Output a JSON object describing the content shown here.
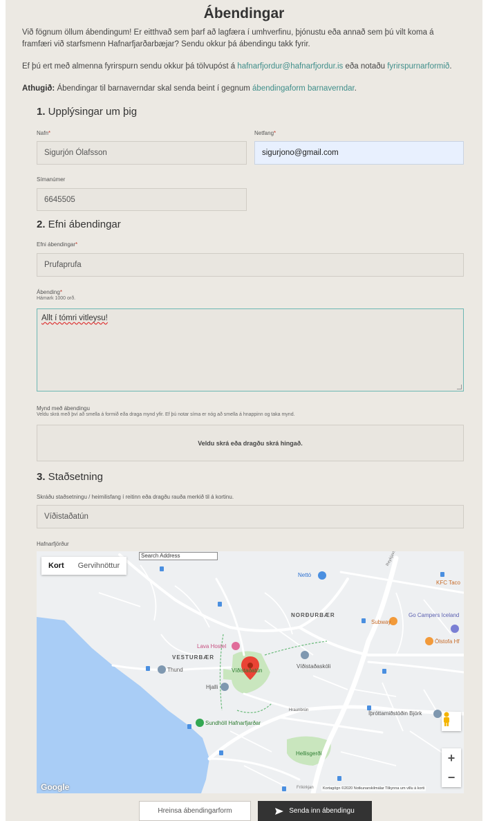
{
  "page": {
    "title": "Ábendingar",
    "intro_1": "Við fögnum öllum ábendingum! Er eitthvað sem þarf að lagfæra í umhverfinu, þjónustu eða annað sem þú vilt koma á framfæri við starfsmenn Hafnarfjarðarbæjar? Sendu okkur þá ábendingu takk fyrir.",
    "intro_2_pre": "Ef þú ert með almenna fyrirspurn sendu okkur þá tölvupóst á ",
    "intro_2_email": "hafnarfjordur@hafnarfjordur.is",
    "intro_2_mid": " eða notaðu ",
    "intro_2_link": "fyrirspurnarformið",
    "intro_2_end": ".",
    "note_bold": "Athugið:",
    "note_text": " Ábendingar til barnaverndar skal senda beint í gegnum ",
    "note_link": "ábendingaform barnaverndar",
    "note_end": "."
  },
  "section1": {
    "num": "1.",
    "title": " Upplýsingar um þig",
    "name_label": "Nafn",
    "name_value": "Sigurjón Ólafsson",
    "email_label": "Netfang",
    "email_value": "sigurjono@gmail.com",
    "phone_label": "Símanúmer",
    "phone_value": "6645505"
  },
  "section2": {
    "num": "2.",
    "title": " Efni ábendingar",
    "subject_label": "Efni ábendingar",
    "subject_value": "Prufaprufa",
    "message_label": "Ábending",
    "message_hint": "Hámark 1000 orð.",
    "message_value": "Allt í tómri vitleysu!",
    "image_label": "Mynd með ábendingu",
    "image_hint": "Veldu skrá með því að smella á formið eða draga mynd yfir. Ef þú notar síma er nóg að smella á hnappinn og taka mynd.",
    "dropzone_text": "Veldu skrá eða dragðu skrá hingað."
  },
  "section3": {
    "num": "3.",
    "title": " Staðsetning",
    "location_label": "Skráðu staðsetningu / heimilisfang í reitinn eða dragðu rauða merkið til á kortinu.",
    "location_value": "Víðistaðatún",
    "town_label": "Hafnarfjörður"
  },
  "map": {
    "tab_map": "Kort",
    "tab_satellite": "Gervihnöttur",
    "search_placeholder": "Search Address",
    "labels": {
      "netto": "Nettó",
      "kfc": "KFC Taco",
      "nordurbaer": "NORÐURBÆR",
      "go_campers": "Go Campers Iceland",
      "subway": "Subway",
      "olstofa": "Ölstofa Hf",
      "lava_hostel": "Lava Hostel",
      "vesturbaer": "VESTURBÆR",
      "vidistadatun": "Víðistaðatún",
      "vidistadaskoli": "Víðistaðaskóli",
      "thund": "Thund",
      "hjalli": "Hjalli",
      "hraunbrun": "Hraunbrún",
      "ithrotta": "Íþróttamiðstöðin Björk",
      "sundholl": "Sundhöll Hafnarfjarðar",
      "hellisgerdi": "Hellisgerði",
      "reykjavikurvegur": "Reykjavíkurvegur",
      "frikirkjan": "Fríkirkjan"
    },
    "zoom_in": "+",
    "zoom_out": "−",
    "google": "Google",
    "attribution": "Kortagögn ©2020   Notkunarskilmálar   Tilkynna um villu á korti",
    "colors": {
      "water": "#a9cdf6",
      "park": "#c9e6be",
      "pin": "#ea4335"
    }
  },
  "buttons": {
    "clear": "Hreinsa ábendingarform",
    "send": "Senda inn ábendingu"
  }
}
